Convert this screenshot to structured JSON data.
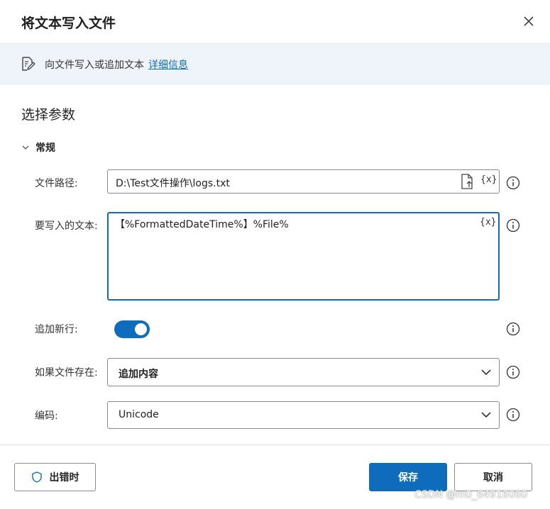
{
  "dialog": {
    "title": "将文本写入文件",
    "close_icon": "close-icon"
  },
  "banner": {
    "icon": "document-edit-icon",
    "text": "向文件写入或追加文本",
    "link": "详细信息"
  },
  "section": {
    "title": "选择参数"
  },
  "group": {
    "label": "常规",
    "expanded": true
  },
  "fields": {
    "file_path": {
      "label": "文件路径:",
      "value": "D:\\Test文件操作\\logs.txt",
      "var_button": "{x}"
    },
    "text_to_write": {
      "label": "要写入的文本:",
      "value": "【%FormattedDateTime%】%File%",
      "var_button": "{x}"
    },
    "append_newline": {
      "label": "追加新行:",
      "enabled": true
    },
    "if_file_exists": {
      "label": "如果文件存在:",
      "value": "追加内容"
    },
    "encoding": {
      "label": "编码:",
      "value": "Unicode"
    }
  },
  "footer": {
    "on_error_label": "出错时",
    "save_label": "保存",
    "cancel_label": "取消"
  },
  "watermark": "CSDN @m0_64916060",
  "colors": {
    "accent": "#0f6cbd",
    "banner_bg": "#eff4fb"
  }
}
